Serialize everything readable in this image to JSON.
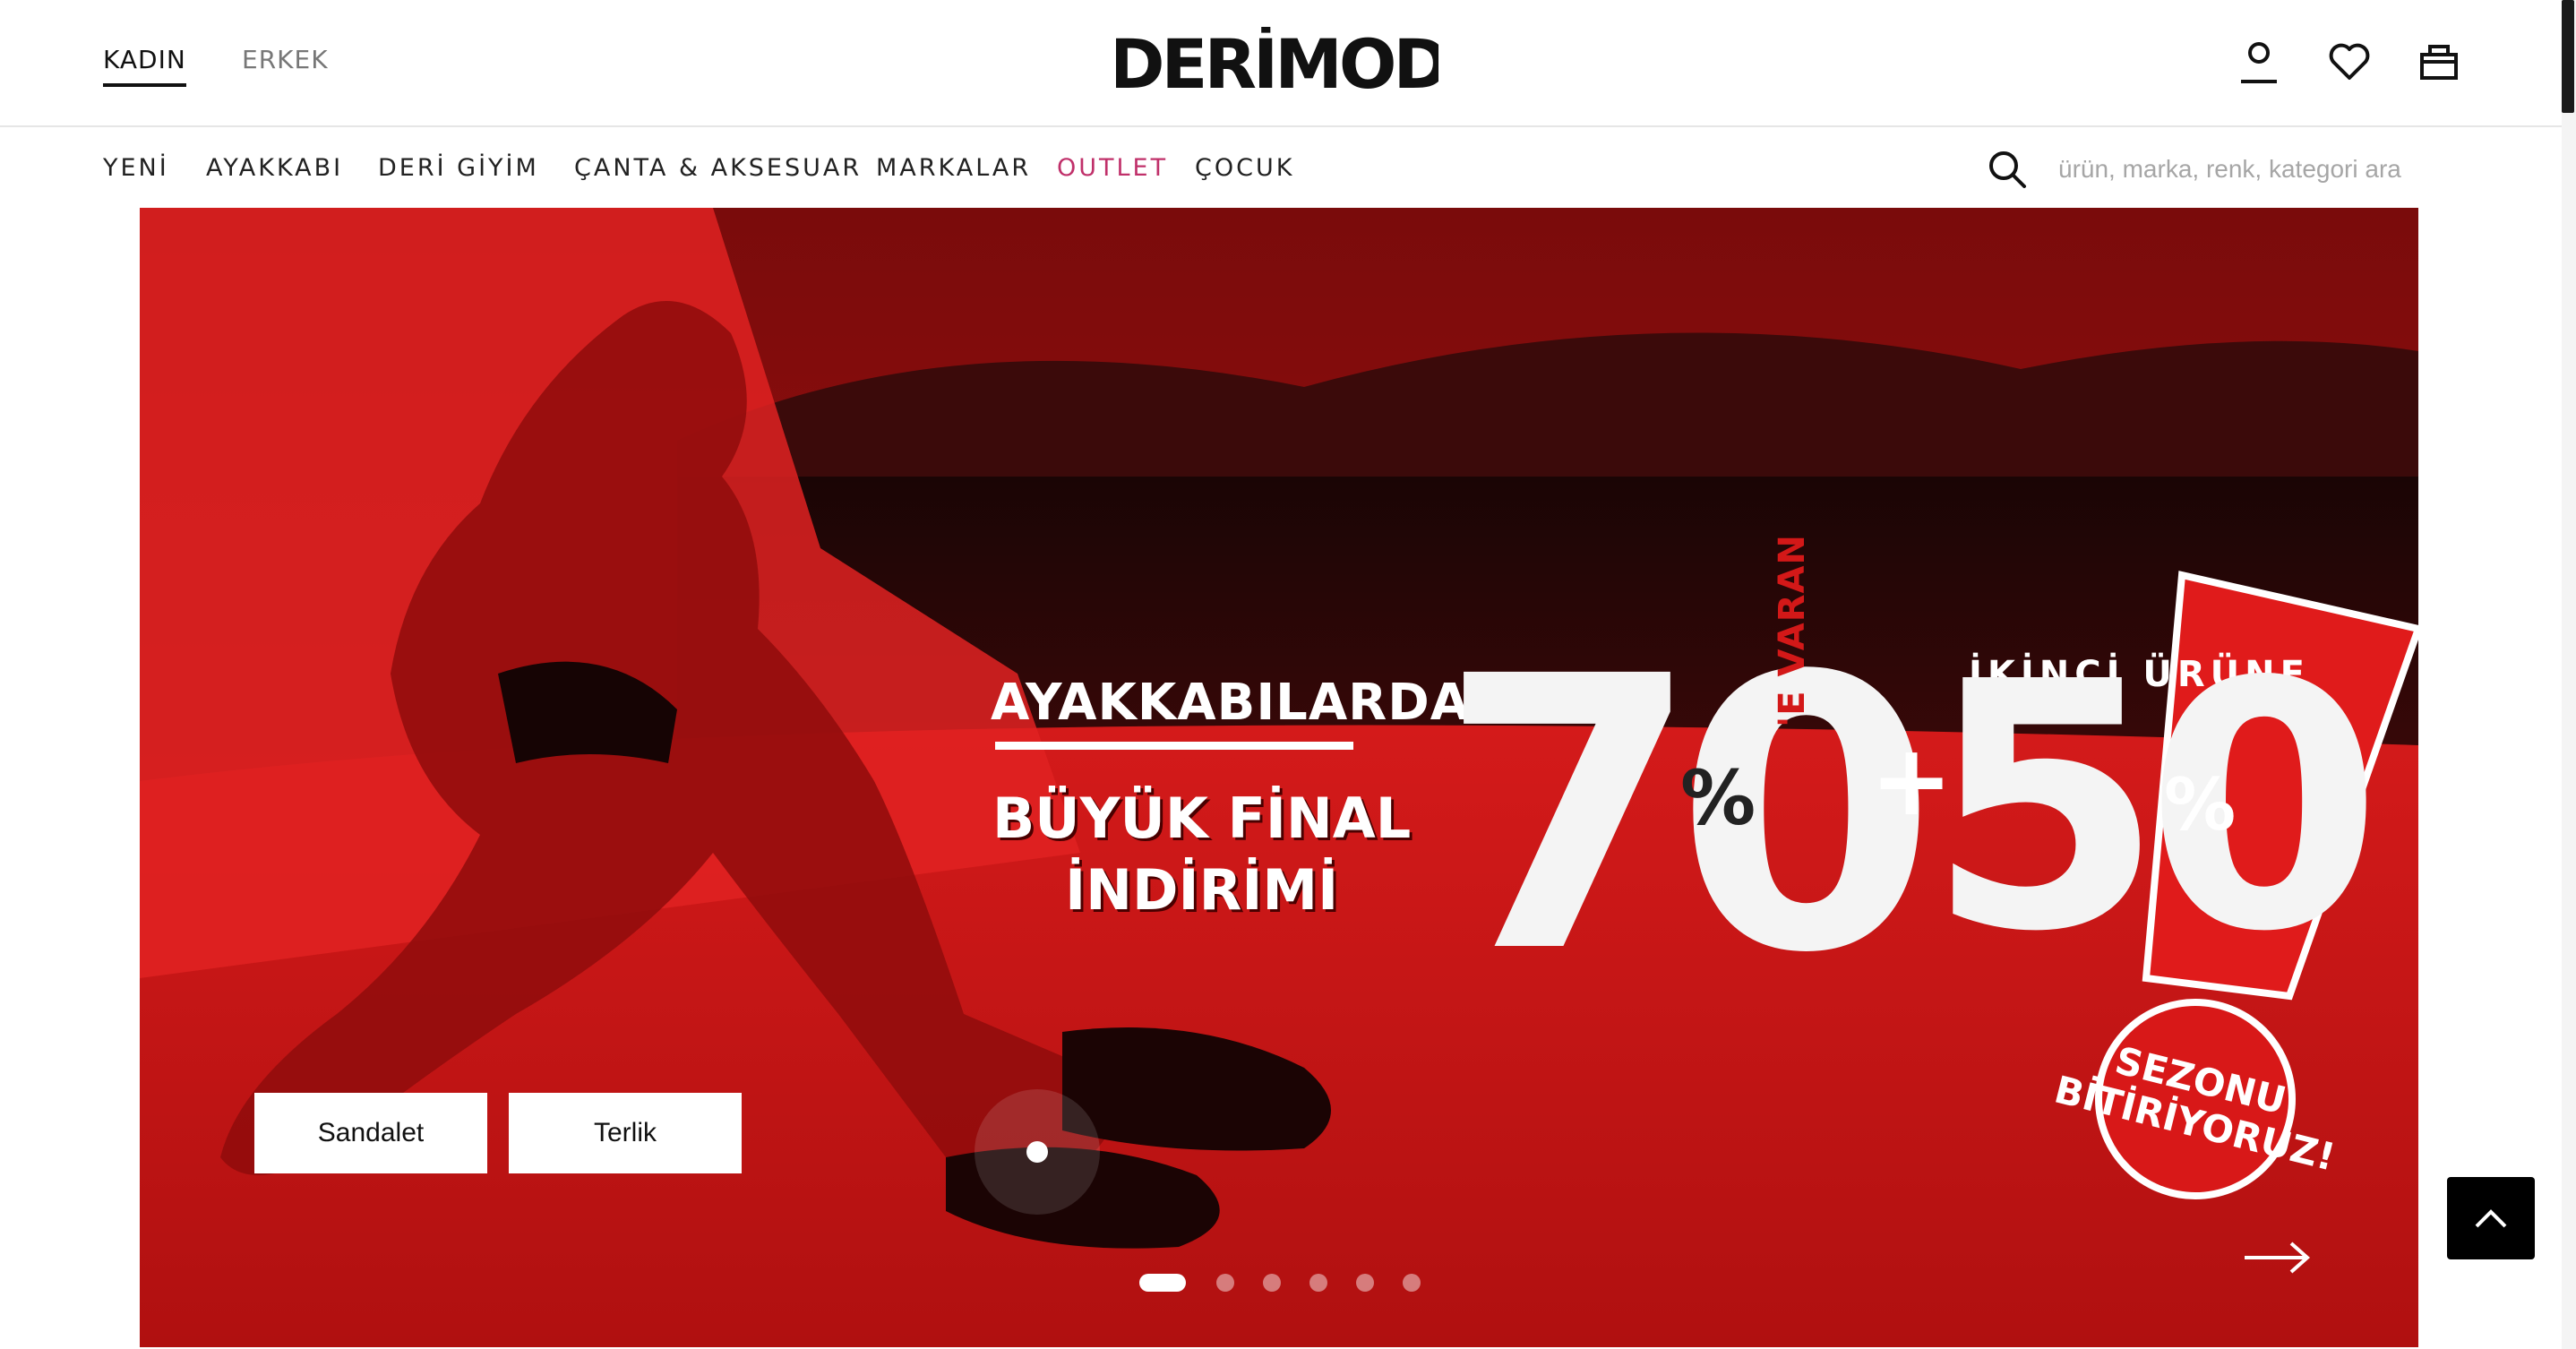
{
  "header": {
    "gender_tabs": [
      {
        "label": "KADIN",
        "active": true
      },
      {
        "label": "ERKEK",
        "active": false
      }
    ],
    "logo_text": "DERİMOD",
    "icons": [
      "user-icon",
      "heart-icon",
      "bag-icon"
    ]
  },
  "nav": {
    "items": [
      "YENİ",
      "AYAKKABI",
      "DERİ GİYİM",
      "ÇANTA & AKSESUAR",
      "MARKALAR",
      "OUTLET",
      "ÇOCUK"
    ],
    "outlet_color": "#c0306a"
  },
  "search": {
    "placeholder": "ürün, marka, renk, kategori ara"
  },
  "hero": {
    "headline_top": "AYAKKABILARDA",
    "headline_line1": "BÜYÜK FİNAL",
    "headline_line2": "İNDİRİMİ",
    "discount_1": "70",
    "discount_1_pct": "%",
    "discount_1_suffix": "'E VARAN",
    "plus": "+",
    "second_label": "İKİNCİ ÜRÜNE",
    "discount_2": "50",
    "discount_2_pct": "%",
    "seal_line1": "SEZONU",
    "seal_line2": "BİTİRİYORUZ!",
    "buttons": [
      "Sandalet",
      "Terlik"
    ],
    "slides_total": 6,
    "slide_active": 1,
    "accent_color": "#c81414"
  }
}
